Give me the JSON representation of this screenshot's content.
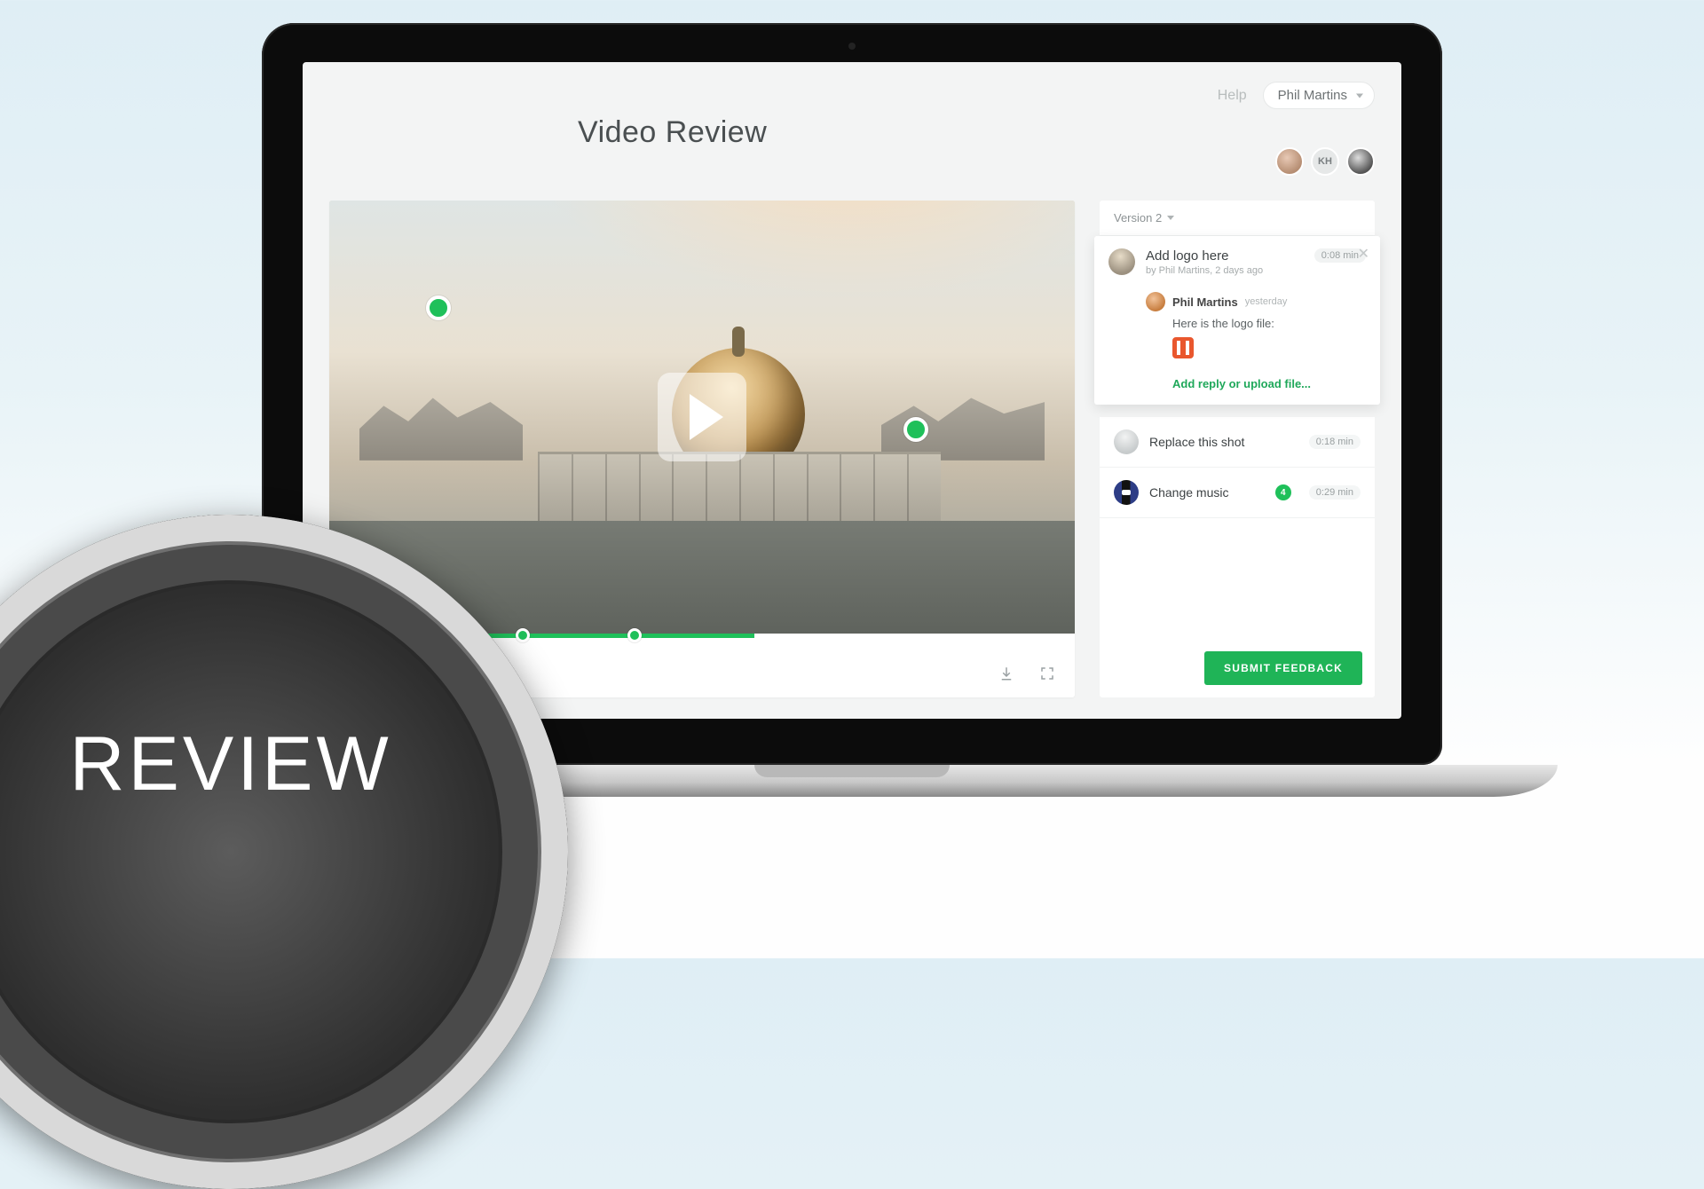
{
  "overlay": {
    "badge_text": "REVIEW"
  },
  "topbar": {
    "help": "Help",
    "user_name": "Phil Martins"
  },
  "page": {
    "title": "Video Review"
  },
  "collaborators": [
    {
      "initials": ""
    },
    {
      "initials": "KH"
    },
    {
      "initials": ""
    }
  ],
  "video": {
    "annotations": [
      {
        "id": "m1"
      },
      {
        "id": "m2"
      }
    ],
    "timeline_markers": [
      "d1",
      "d2",
      "d3"
    ],
    "progress_percent": 57
  },
  "sidebar": {
    "version_label": "Version 2",
    "active_comment": {
      "title": "Add logo here",
      "author": "Phil Martins",
      "age": "2 days ago",
      "byline": "by Phil Martins, 2 days ago",
      "timestamp": "0:08 min",
      "reply": {
        "author": "Phil Martins",
        "when": "yesterday",
        "text": "Here is the logo file:"
      },
      "action": "Add reply or upload file..."
    },
    "comments": [
      {
        "title": "Replace this shot",
        "timestamp": "0:18 min",
        "count": null,
        "thumb": "shot"
      },
      {
        "title": "Change music",
        "timestamp": "0:29 min",
        "count": 4,
        "thumb": "music"
      }
    ],
    "submit_label": "SUBMIT FEEDBACK"
  }
}
